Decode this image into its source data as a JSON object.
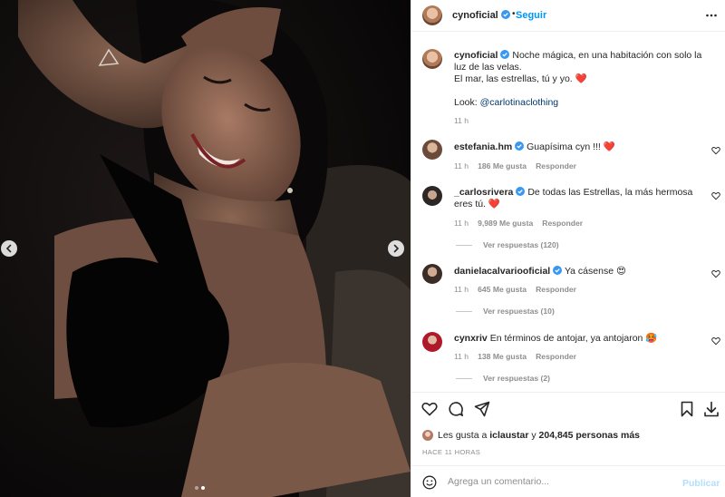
{
  "header": {
    "username": "cynoficial",
    "separator": "•",
    "follow_label": "Seguir"
  },
  "caption": {
    "username": "cynoficial",
    "line1": "Noche mágica, en una habitación con solo la luz de las velas.",
    "line2": "El mar, las estrellas, tú y yo.",
    "heart": "❤️",
    "look_label": "Look:",
    "look_mention": "@carlotinaclothing",
    "time": "11 h"
  },
  "comments": [
    {
      "username": "estefania.hm",
      "text": "Guapísima cyn !!! ❤️",
      "time": "11 h",
      "likes": "186 Me gusta",
      "reply_label": "Responder",
      "view_replies": ""
    },
    {
      "username": "_carlosrivera",
      "text": "De todas las Estrellas, la más hermosa eres tú. ❤️",
      "time": "11 h",
      "likes": "9,989 Me gusta",
      "reply_label": "Responder",
      "view_replies": "Ver respuestas (120)"
    },
    {
      "username": "danielacalvariooficial",
      "text": "Ya cásense 😍",
      "time": "11 h",
      "likes": "645 Me gusta",
      "reply_label": "Responder",
      "view_replies": "Ver respuestas (10)"
    },
    {
      "username": "cynxriv",
      "text": "En términos de antojar, ya antojaron 🥵",
      "time": "11 h",
      "likes": "138 Me gusta",
      "reply_label": "Responder",
      "view_replies": "Ver respuestas (2)"
    }
  ],
  "likes_summary": {
    "prefix": "Les gusta a",
    "first_user": "iclaustar",
    "middle": "y",
    "others": "204,845 personas más"
  },
  "time_ago": "HACE 11 HORAS",
  "add_comment": {
    "placeholder": "Agrega un comentario...",
    "publish_label": "Publicar"
  },
  "icons": {
    "verified": "verified-badge-icon",
    "more": "more-options-icon",
    "like": "heart-icon",
    "comment": "comment-icon",
    "share": "share-icon",
    "save": "bookmark-icon",
    "download": "download-icon",
    "emoji": "emoji-icon",
    "prev": "chevron-left-icon",
    "next": "chevron-right-icon"
  },
  "colors": {
    "accent": "#0095f6",
    "verified": "#3897f0",
    "text": "#262626",
    "muted": "#8e8e8e",
    "heart": "#ed1c24",
    "publish_disabled": "#b2dffc"
  },
  "carousel": {
    "total": 2,
    "active": 2
  }
}
